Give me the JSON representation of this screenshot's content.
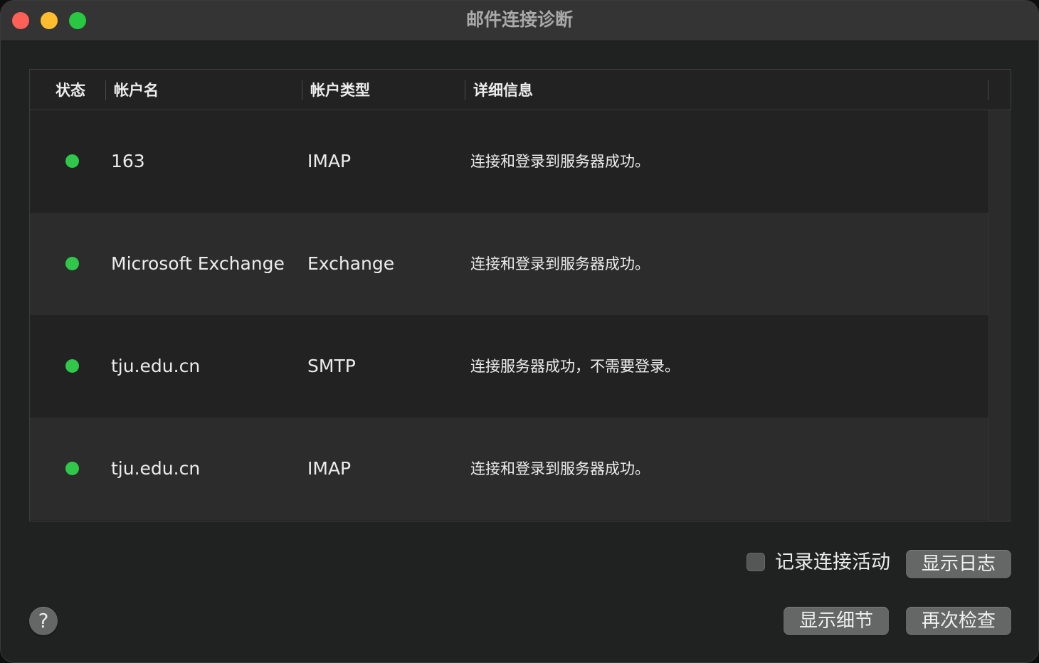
{
  "window": {
    "title": "邮件连接诊断"
  },
  "table": {
    "columns": {
      "status": "状态",
      "account_name": "帐户名",
      "account_type": "帐户类型",
      "details": "详细信息"
    },
    "rows": [
      {
        "status": "connected",
        "name": "163",
        "type": "IMAP",
        "detail": "连接和登录到服务器成功。"
      },
      {
        "status": "connected",
        "name": "Microsoft Exchange",
        "type": "Exchange",
        "detail": "连接和登录到服务器成功。"
      },
      {
        "status": "connected",
        "name": "tju.edu.cn",
        "type": "SMTP",
        "detail": "连接服务器成功，不需要登录。"
      },
      {
        "status": "connected",
        "name": "tju.edu.cn",
        "type": "IMAP",
        "detail": "连接和登录到服务器成功。"
      }
    ],
    "status_color": "#2fc84b"
  },
  "footer": {
    "log_activity_label": "记录连接活动",
    "log_activity_checked": false,
    "show_log_label": "显示日志",
    "show_details_label": "显示细节",
    "check_again_label": "再次检查",
    "help_label": "?"
  }
}
